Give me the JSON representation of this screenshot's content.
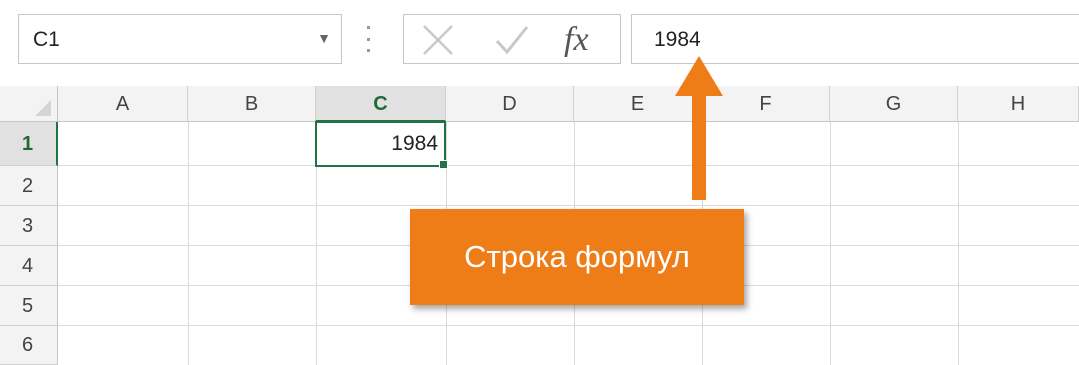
{
  "name_box": {
    "value": "C1",
    "dropdown_icon": "chevron-down-icon"
  },
  "formula_bar": {
    "cancel_icon": "close-icon",
    "enter_icon": "checkmark-icon",
    "fx_label": "fx",
    "value": "1984"
  },
  "columns": [
    "A",
    "B",
    "C",
    "D",
    "E",
    "F",
    "G",
    "H"
  ],
  "active_column": "C",
  "rows": [
    "1",
    "2",
    "3",
    "4",
    "5",
    "6"
  ],
  "active_row": "1",
  "cells": {
    "C1": "1984"
  },
  "callout": {
    "text": "Строка формул"
  },
  "colors": {
    "accent_green": "#217346",
    "callout_orange": "#ef7d17",
    "header_bg": "#f3f3f3",
    "gridline": "#dadada"
  }
}
